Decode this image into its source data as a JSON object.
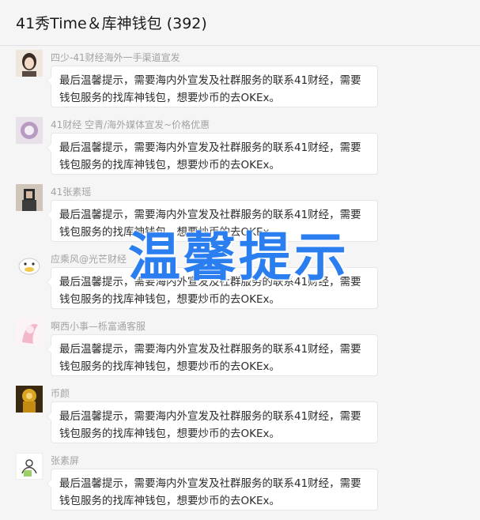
{
  "header": {
    "title": "41秀Time＆库神钱包 (392)"
  },
  "messages": [
    {
      "sender": "四少-41财经海外一手渠道宣发",
      "text": "最后温馨提示，需要海内外宣发及社群服务的联系41财经，需要钱包服务的找库神钱包，想要炒币的去OKEx。"
    },
    {
      "sender": "41财经 空青/海外媒体宣发~价格优惠",
      "text": "最后温馨提示，需要海内外宣发及社群服务的联系41财经，需要钱包服务的找库神钱包，想要炒币的去OKEx。"
    },
    {
      "sender": "41张素瑶",
      "text": "最后温馨提示，需要海内外宣发及社群服务的联系41财经，需要钱包服务的找库神钱包，想要炒币的去OKEx。"
    },
    {
      "sender": "应乘风@光芒财经",
      "text": "最后温馨提示，需要海内外宣发及社群服务的联系41财经，需要钱包服务的找库神钱包，想要炒币的去OKEx。"
    },
    {
      "sender": "啊西小事—栎富通客服",
      "text": "最后温馨提示，需要海内外宣发及社群服务的联系41财经，需要钱包服务的找库神钱包，想要炒币的去OKEx。"
    },
    {
      "sender": "币颜",
      "text": "最后温馨提示，需要海内外宣发及社群服务的联系41财经，需要钱包服务的找库神钱包，想要炒币的去OKEx。"
    },
    {
      "sender": "张素屏",
      "text": "最后温馨提示，需要海内外宣发及社群服务的联系41财经，需要钱包服务的找库神钱包，想要炒币的去OKEx。"
    }
  ],
  "overlay": {
    "text": "温馨提示",
    "color": "#2a7ef0"
  }
}
